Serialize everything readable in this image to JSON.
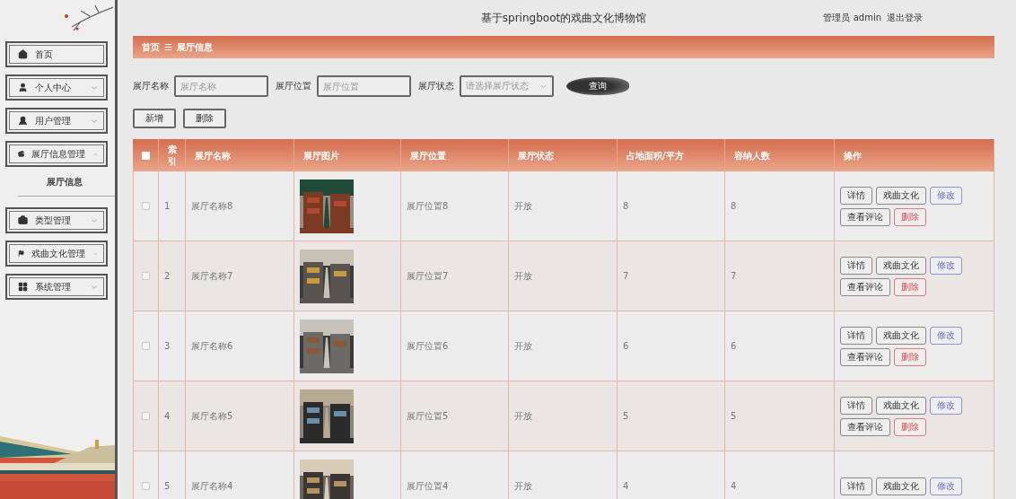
{
  "header": {
    "title": "基于springboot的戏曲文化博物馆",
    "user": "管理员 admin",
    "logout": "退出登录"
  },
  "sidebar": {
    "items": [
      {
        "label": "首页"
      },
      {
        "label": "个人中心",
        "expanded": false
      },
      {
        "label": "用户管理",
        "expanded": false
      },
      {
        "label": "展厅信息管理",
        "expanded": true,
        "children": [
          {
            "label": "展厅信息",
            "selected": true
          }
        ]
      },
      {
        "label": "类型管理",
        "expanded": false
      },
      {
        "label": "戏曲文化管理",
        "expanded": false
      },
      {
        "label": "系统管理",
        "expanded": false
      }
    ]
  },
  "breadcrumb": {
    "items": [
      "首页",
      "展厅信息"
    ],
    "separator": "☰"
  },
  "search": {
    "fields": [
      {
        "label": "展厅名称",
        "placeholder": "展厅名称",
        "kind": "input"
      },
      {
        "label": "展厅位置",
        "placeholder": "展厅位置",
        "kind": "input"
      },
      {
        "label": "展厅状态",
        "placeholder": "请选择展厅状态",
        "kind": "select"
      }
    ],
    "button": "查询"
  },
  "actions": [
    "新增",
    "删除"
  ],
  "table": {
    "select_all": {
      "checked": false
    },
    "columns": [
      "索引",
      "展厅名称",
      "展厅图片",
      "展厅位置",
      "展厅状态",
      "占地面积/平方",
      "容纳人数",
      "操作"
    ],
    "rows": [
      {
        "checked": false,
        "index": "1",
        "name": "展厅名称8",
        "location": "展厅位置8",
        "status": "开放",
        "area": "8",
        "capacity": "8",
        "actions": [
          {
            "label": "详情",
            "kind": "default"
          },
          {
            "label": "戏曲文化",
            "kind": "default"
          },
          {
            "label": "修改",
            "kind": "edit"
          },
          {
            "label": "查看评论",
            "kind": "default"
          },
          {
            "label": "删除",
            "kind": "danger"
          }
        ]
      },
      {
        "checked": false,
        "index": "2",
        "name": "展厅名称7",
        "location": "展厅位置7",
        "status": "开放",
        "area": "7",
        "capacity": "7",
        "actions": [
          {
            "label": "详情",
            "kind": "default"
          },
          {
            "label": "戏曲文化",
            "kind": "default"
          },
          {
            "label": "修改",
            "kind": "edit"
          },
          {
            "label": "查看评论",
            "kind": "default"
          },
          {
            "label": "删除",
            "kind": "danger"
          }
        ]
      },
      {
        "checked": false,
        "index": "3",
        "name": "展厅名称6",
        "location": "展厅位置6",
        "status": "开放",
        "area": "6",
        "capacity": "6",
        "actions": [
          {
            "label": "详情",
            "kind": "default"
          },
          {
            "label": "戏曲文化",
            "kind": "default"
          },
          {
            "label": "修改",
            "kind": "edit"
          },
          {
            "label": "查看评论",
            "kind": "default"
          },
          {
            "label": "删除",
            "kind": "danger"
          }
        ]
      },
      {
        "checked": false,
        "index": "4",
        "name": "展厅名称5",
        "location": "展厅位置5",
        "status": "开放",
        "area": "5",
        "capacity": "5",
        "actions": [
          {
            "label": "详情",
            "kind": "default"
          },
          {
            "label": "戏曲文化",
            "kind": "default"
          },
          {
            "label": "修改",
            "kind": "edit"
          },
          {
            "label": "查看评论",
            "kind": "default"
          },
          {
            "label": "删除",
            "kind": "danger"
          }
        ]
      },
      {
        "checked": false,
        "index": "5",
        "name": "展厅名称4",
        "location": "展厅位置4",
        "status": "开放",
        "area": "4",
        "capacity": "4",
        "actions": [
          {
            "label": "详情",
            "kind": "default"
          },
          {
            "label": "戏曲文化",
            "kind": "default"
          },
          {
            "label": "修改",
            "kind": "edit"
          }
        ]
      }
    ]
  }
}
